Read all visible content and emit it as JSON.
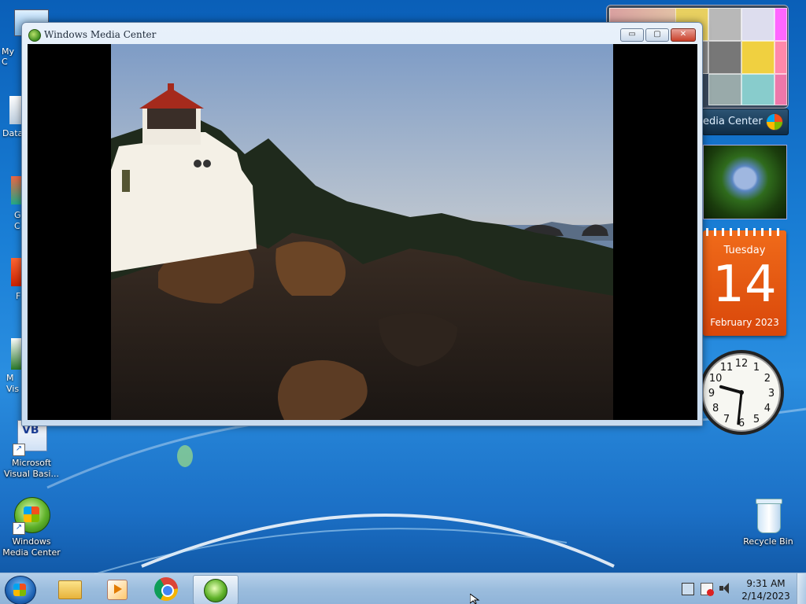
{
  "desktop": {
    "icons": [
      {
        "label": "My C",
        "icon": "computer-icon"
      },
      {
        "label": "Data",
        "icon": "database-shortcut-icon"
      },
      {
        "label": "G\nC",
        "icon": "app-shortcut-icon"
      },
      {
        "label": "F",
        "icon": "app-shortcut-icon"
      },
      {
        "label": "M\nVis",
        "icon": "app-shortcut-icon"
      },
      {
        "label": "Microsoft Visual Basi...",
        "icon": "visual-basic-icon"
      },
      {
        "label": "Windows Media Center",
        "icon": "windows-media-center-icon"
      },
      {
        "label": "Recycle Bin",
        "icon": "recycle-bin-icon"
      }
    ]
  },
  "window": {
    "title": "Windows Media Center",
    "minimize": "▭",
    "maximize": "▢",
    "close": "✕",
    "content": "lighthouse-photo"
  },
  "gadgets": {
    "media_center": {
      "label": "edia Center"
    },
    "calendar": {
      "day_name": "Tuesday",
      "day": "14",
      "month_year": "February 2023"
    },
    "clock": {
      "hour": 9,
      "minute": 31,
      "numbers": [
        "12",
        "1",
        "2",
        "3",
        "4",
        "5",
        "6",
        "7",
        "8",
        "9",
        "10",
        "11"
      ]
    }
  },
  "taskbar": {
    "items": [
      {
        "name": "start-button",
        "icon": "windows-orb-icon"
      },
      {
        "name": "explorer",
        "icon": "folder-icon"
      },
      {
        "name": "media-player",
        "icon": "media-player-icon"
      },
      {
        "name": "chrome",
        "icon": "chrome-icon"
      },
      {
        "name": "media-center",
        "icon": "windows-media-center-icon",
        "active": true
      }
    ],
    "clock": {
      "time": "9:31 AM",
      "date": "2/14/2023"
    },
    "tray_icons": [
      "network-icon",
      "action-center-flag-icon",
      "volume-icon"
    ]
  }
}
